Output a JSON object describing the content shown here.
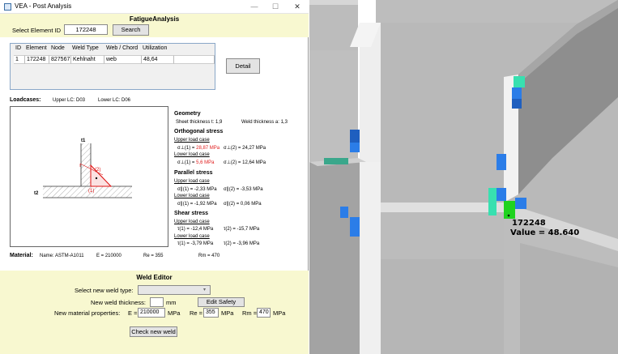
{
  "window": {
    "title": "VEA - Post Analysis"
  },
  "header": {
    "title": "FatigueAnalysis",
    "select_label": "Select Element ID",
    "element_id": "172248",
    "search_label": "Search"
  },
  "grid": {
    "columns": [
      "ID",
      "Element",
      "Node",
      "Weld Type",
      "Web / Chord",
      "Utilization"
    ],
    "row": [
      "1",
      "172248",
      "827567",
      "Kehlnaht",
      "web",
      "48,64"
    ]
  },
  "detail_label": "Detail",
  "loadcases": {
    "label": "Loadcases:",
    "upper": "Upper LC:  D03",
    "lower": "Lower LC:  D06"
  },
  "diagram": {
    "t1": "t1",
    "t2": "t2",
    "l1": "(1)",
    "l2": "(2)"
  },
  "geometry": {
    "title": "Geometry",
    "sheet": "Sheet thickness t: 1,9",
    "weld": "Weld thickness a: 1,3"
  },
  "orthogonal": {
    "title": "Orthogonal stress",
    "upper": "Upper load case",
    "u1": "σ⊥(1) = 28,87 MPa",
    "u2": "σ⊥(2) = 24,27 MPa",
    "lower": "Lower load case",
    "l1": "σ⊥(1) = 5,6 MPa",
    "l2": "σ⊥(2) = 12,64 MPa"
  },
  "parallel": {
    "title": "Parallel stress",
    "upper": "Upper load case",
    "u1": "σ∥(1) =  -2,33 MPa",
    "u2": "σ∥(2) =  -3,53 MPa",
    "lower": "Lower load case",
    "l1": "σ∥(1) =  -1,92 MPa",
    "l2": "σ∥(2) =  0,06 MPa"
  },
  "shear": {
    "title": "Shear stress",
    "upper": "Upper load case",
    "u1": "τ(1) =   -12,4 MPa",
    "u2": "τ(2) =    -15,7 MPa",
    "lower": "Lower load case",
    "l1": "τ(1) =   -3,79 MPa",
    "l2": "τ(2) =   -3,96 MPa"
  },
  "material": {
    "label": "Material:",
    "name": "Name:  ASTM-A1011",
    "e": "E = 210000",
    "re": "Re = 355",
    "rm": "Rm = 470"
  },
  "weld_editor": {
    "title": "Weld Editor",
    "type_label": "Select new weld type:",
    "thickness_label": "New weld thickness:",
    "thickness_unit": "mm",
    "edit_safety": "Edit Safety",
    "props_label": "New material properties:",
    "e_label": "E =",
    "e_value": "210000",
    "mpa": "MPa",
    "re_label": "Re =",
    "re_value": "355",
    "rm_label": "Rm =",
    "rm_value": "470",
    "check_label": "Check new weld"
  },
  "view3d": {
    "node": "172248",
    "value_text": "Value = 48.640"
  }
}
